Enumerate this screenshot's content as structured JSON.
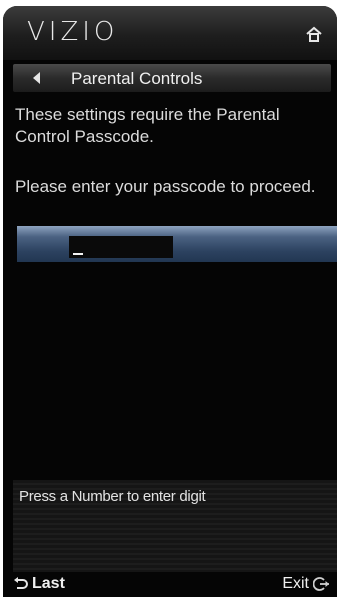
{
  "header": {
    "logo": "VIZIO",
    "home_icon": "home-icon"
  },
  "breadcrumb": {
    "back_icon": "back-arrow-icon",
    "title": "Parental Controls"
  },
  "content": {
    "message_line1": "These settings require the Parental Control Passcode.",
    "message_line2": "Please enter your passcode to proceed.",
    "passcode_value": ""
  },
  "hint": {
    "text": "Press a Number to enter digit"
  },
  "footer": {
    "last_icon": "return-arrow-icon",
    "last_label": "Last",
    "exit_label": "Exit",
    "exit_icon": "exit-icon"
  },
  "colors": {
    "background": "#050505",
    "text": "#dcdcdc",
    "highlight_bar": "#3d5576"
  }
}
